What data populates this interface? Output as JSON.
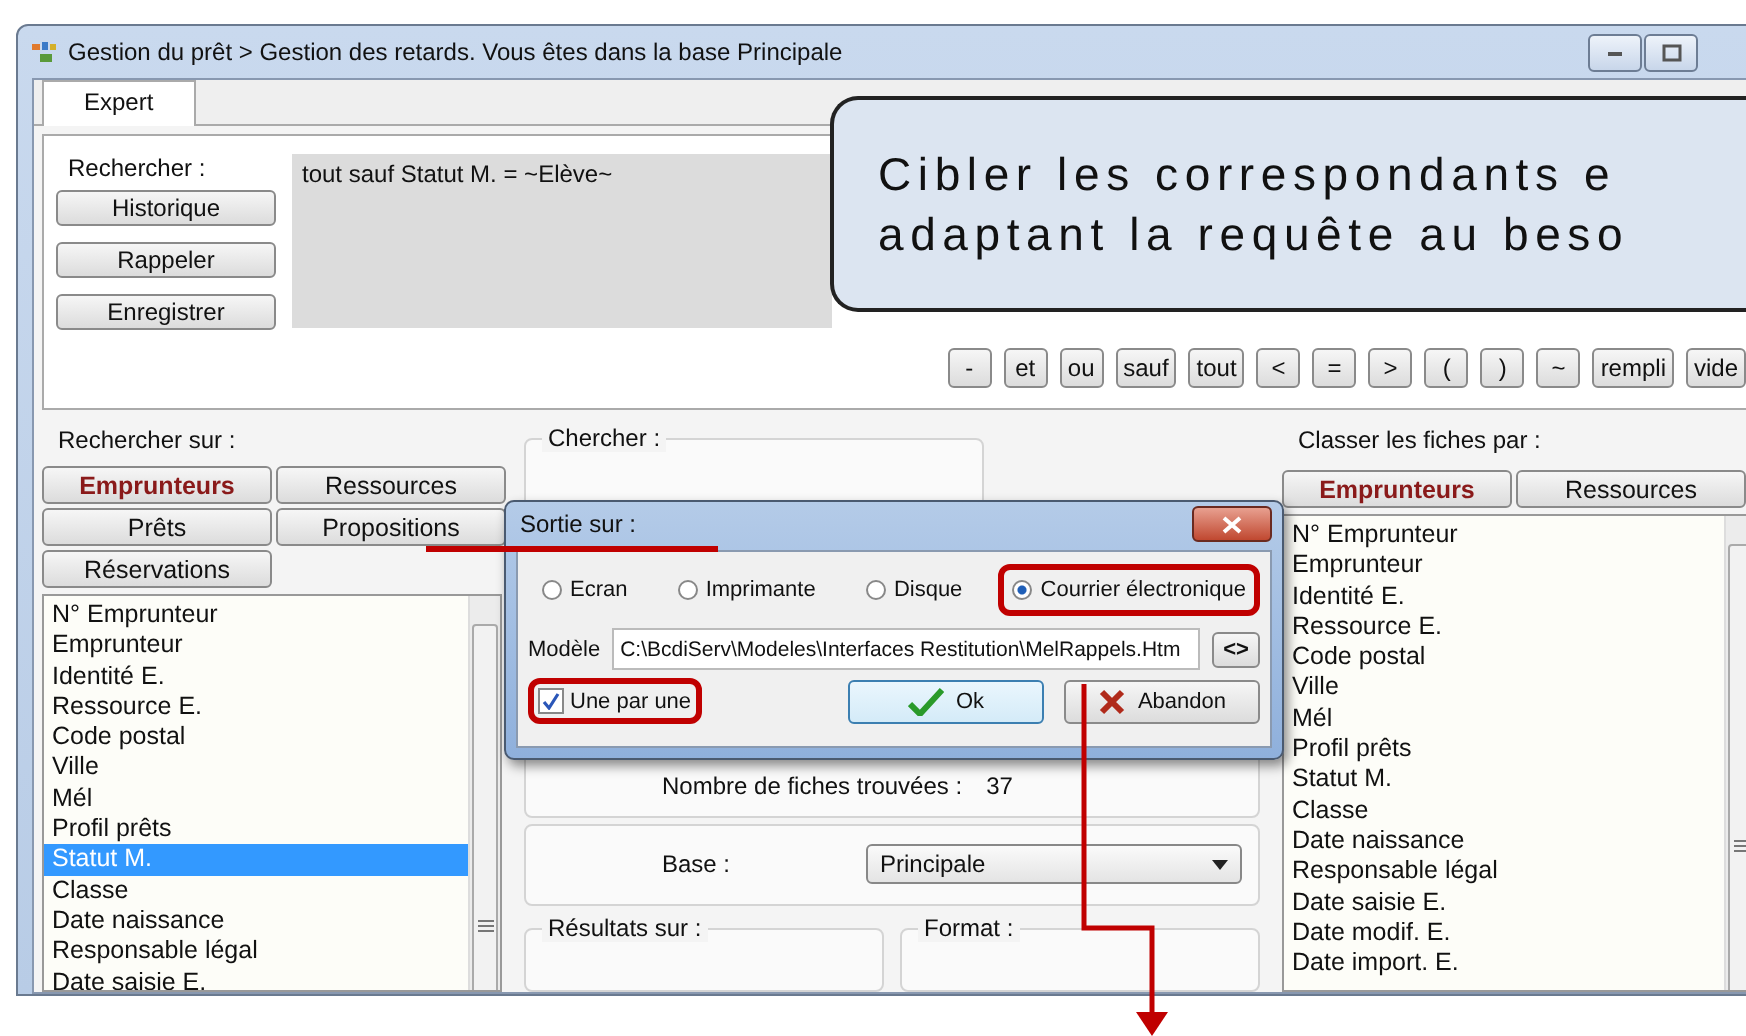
{
  "window": {
    "title": "Gestion du prêt > Gestion des retards.  Vous êtes dans la base Principale"
  },
  "tabs": [
    {
      "label": "Expert",
      "selected": true
    }
  ],
  "query": {
    "label": "Rechercher :",
    "buttons": [
      "Historique",
      "Rappeler",
      "Enregistrer"
    ],
    "value": "tout sauf Statut M. = ~Elève~",
    "operators": [
      "-",
      "et",
      "ou",
      "sauf",
      "tout",
      "<",
      "=",
      ">",
      "(",
      ")",
      "~",
      "rempli",
      "vide"
    ]
  },
  "callout": {
    "lines": [
      "Cibler les correspondants e",
      "adaptant la requête au beso"
    ]
  },
  "search_on": {
    "title": "Rechercher sur :",
    "buttons": [
      {
        "label": "Emprunteurs",
        "selected": true
      },
      {
        "label": "Ressources",
        "selected": false
      },
      {
        "label": "Prêts",
        "selected": false
      },
      {
        "label": "Propositions",
        "selected": false
      },
      {
        "label": "Réservations",
        "selected": false
      }
    ],
    "fields": [
      {
        "label": "N° Emprunteur",
        "selected": false
      },
      {
        "label": "Emprunteur",
        "selected": false
      },
      {
        "label": "Identité E.",
        "selected": false
      },
      {
        "label": "Ressource E.",
        "selected": false
      },
      {
        "label": "Code postal",
        "selected": false
      },
      {
        "label": "Ville",
        "selected": false
      },
      {
        "label": "Mél",
        "selected": false
      },
      {
        "label": "Profil prêts",
        "selected": false
      },
      {
        "label": "Statut M.",
        "selected": true
      },
      {
        "label": "Classe",
        "selected": false
      },
      {
        "label": "Date naissance",
        "selected": false
      },
      {
        "label": "Responsable légal",
        "selected": false
      },
      {
        "label": "Date saisie E.",
        "selected": false
      }
    ]
  },
  "find": {
    "title": "Chercher :",
    "count_label": "Nombre de fiches trouvées :",
    "count": "37",
    "base_label": "Base :",
    "base_value": "Principale",
    "results_title": "Résultats sur :",
    "format_title": "Format :"
  },
  "sort_by": {
    "title": "Classer les fiches par :",
    "buttons": [
      {
        "label": "Emprunteurs",
        "selected": true
      },
      {
        "label": "Ressources",
        "selected": false
      }
    ],
    "fields": [
      {
        "label": "N° Emprunteur",
        "selected": false
      },
      {
        "label": "Emprunteur",
        "selected": false
      },
      {
        "label": "Identité E.",
        "selected": false
      },
      {
        "label": "Ressource E.",
        "selected": false
      },
      {
        "label": "Code postal",
        "selected": false
      },
      {
        "label": "Ville",
        "selected": false
      },
      {
        "label": "Mél",
        "selected": false
      },
      {
        "label": "Profil prêts",
        "selected": false
      },
      {
        "label": "Statut M.",
        "selected": false
      },
      {
        "label": "Classe",
        "selected": false
      },
      {
        "label": "Date naissance",
        "selected": false
      },
      {
        "label": "Responsable légal",
        "selected": false
      },
      {
        "label": "Date saisie E.",
        "selected": false
      },
      {
        "label": "Date modif. E.",
        "selected": false
      },
      {
        "label": "Date import. E.",
        "selected": false
      }
    ]
  },
  "dialog": {
    "title": "Sortie sur :",
    "outputs": [
      {
        "label": "Ecran",
        "selected": false,
        "highlighted": false
      },
      {
        "label": "Imprimante",
        "selected": false,
        "highlighted": false
      },
      {
        "label": "Disque",
        "selected": false,
        "highlighted": false
      },
      {
        "label": "Courrier électronique",
        "selected": true,
        "highlighted": true
      }
    ],
    "template_label": "Modèle",
    "template_path": "C:\\BcdiServ\\Modeles\\Interfaces Restitution\\MelRappels.Htm",
    "browse": "<>",
    "one_by_one": {
      "label": "Une par une",
      "checked": true,
      "highlighted": true
    },
    "ok": "Ok",
    "cancel": "Abandon"
  }
}
